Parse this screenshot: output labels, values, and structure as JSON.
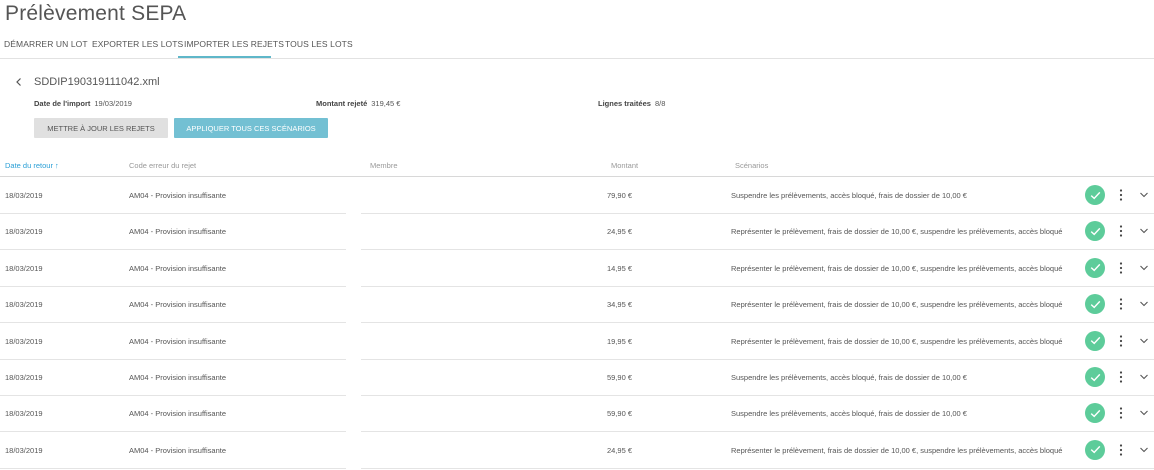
{
  "page_title": "Prélèvement SEPA",
  "tabs": [
    {
      "label": "DÉMARRER UN LOT"
    },
    {
      "label": "EXPORTER LES LOTS"
    },
    {
      "label": "IMPORTER LES REJETS"
    },
    {
      "label": "TOUS LES LOTS"
    }
  ],
  "active_tab": "IMPORTER LES REJETS",
  "file": {
    "name": "SDDIP190319111042.xml"
  },
  "meta": {
    "import_date_label": "Date de l'import",
    "import_date_value": "19/03/2019",
    "amount_label": "Montant rejeté",
    "amount_value": "319,45 €",
    "lines_label": "Lignes traitées",
    "lines_value": "8/8"
  },
  "buttons": {
    "update_label": "METTRE À JOUR LES REJETS",
    "apply_label": "APPLIQUER TOUS CES SCÉNARIOS"
  },
  "table": {
    "headers": {
      "date": "Date du retour ↑",
      "code": "Code erreur du rejet",
      "member": "Membre",
      "amount": "Montant",
      "scenarios": "Scénarios"
    },
    "rows": [
      {
        "date": "18/03/2019",
        "code": "AM04 - Provision insuffisante",
        "member": "",
        "amount": "79,90 €",
        "scenario": "Suspendre les prélèvements, accès bloqué, frais de dossier de 10,00 €"
      },
      {
        "date": "18/03/2019",
        "code": "AM04 - Provision insuffisante",
        "member": "",
        "amount": "24,95 €",
        "scenario": "Représenter le prélèvement, frais de dossier de 10,00 €, suspendre les prélèvements, accès bloqué"
      },
      {
        "date": "18/03/2019",
        "code": "AM04 - Provision insuffisante",
        "member": "",
        "amount": "14,95 €",
        "scenario": "Représenter le prélèvement, frais de dossier de 10,00 €, suspendre les prélèvements, accès bloqué"
      },
      {
        "date": "18/03/2019",
        "code": "AM04 - Provision insuffisante",
        "member": "",
        "amount": "34,95 €",
        "scenario": "Représenter le prélèvement, frais de dossier de 10,00 €, suspendre les prélèvements, accès bloqué"
      },
      {
        "date": "18/03/2019",
        "code": "AM04 - Provision insuffisante",
        "member": "",
        "amount": "19,95 €",
        "scenario": "Représenter le prélèvement, frais de dossier de 10,00 €, suspendre les prélèvements, accès bloqué"
      },
      {
        "date": "18/03/2019",
        "code": "AM04 - Provision insuffisante",
        "member": "",
        "amount": "59,90 €",
        "scenario": "Suspendre les prélèvements, accès bloqué, frais de dossier de 10,00 €"
      },
      {
        "date": "18/03/2019",
        "code": "AM04 - Provision insuffisante",
        "member": "",
        "amount": "59,90 €",
        "scenario": "Suspendre les prélèvements, accès bloqué, frais de dossier de 10,00 €"
      },
      {
        "date": "18/03/2019",
        "code": "AM04 - Provision insuffisante",
        "member": "",
        "amount": "24,95 €",
        "scenario": "Représenter le prélèvement, frais de dossier de 10,00 €, suspendre les prélèvements, accès bloqué"
      }
    ]
  },
  "icons": {
    "back": "chevron-left-icon",
    "status": "check-circle-icon",
    "more": "more-vertical-icon",
    "expand": "chevron-down-icon"
  },
  "colors": {
    "accent": "#5fb7c9",
    "primary_button": "#73c0d3",
    "secondary_button": "#e0e0e0",
    "success": "#5dcc9a",
    "sorted_header": "#2a9fd6"
  }
}
